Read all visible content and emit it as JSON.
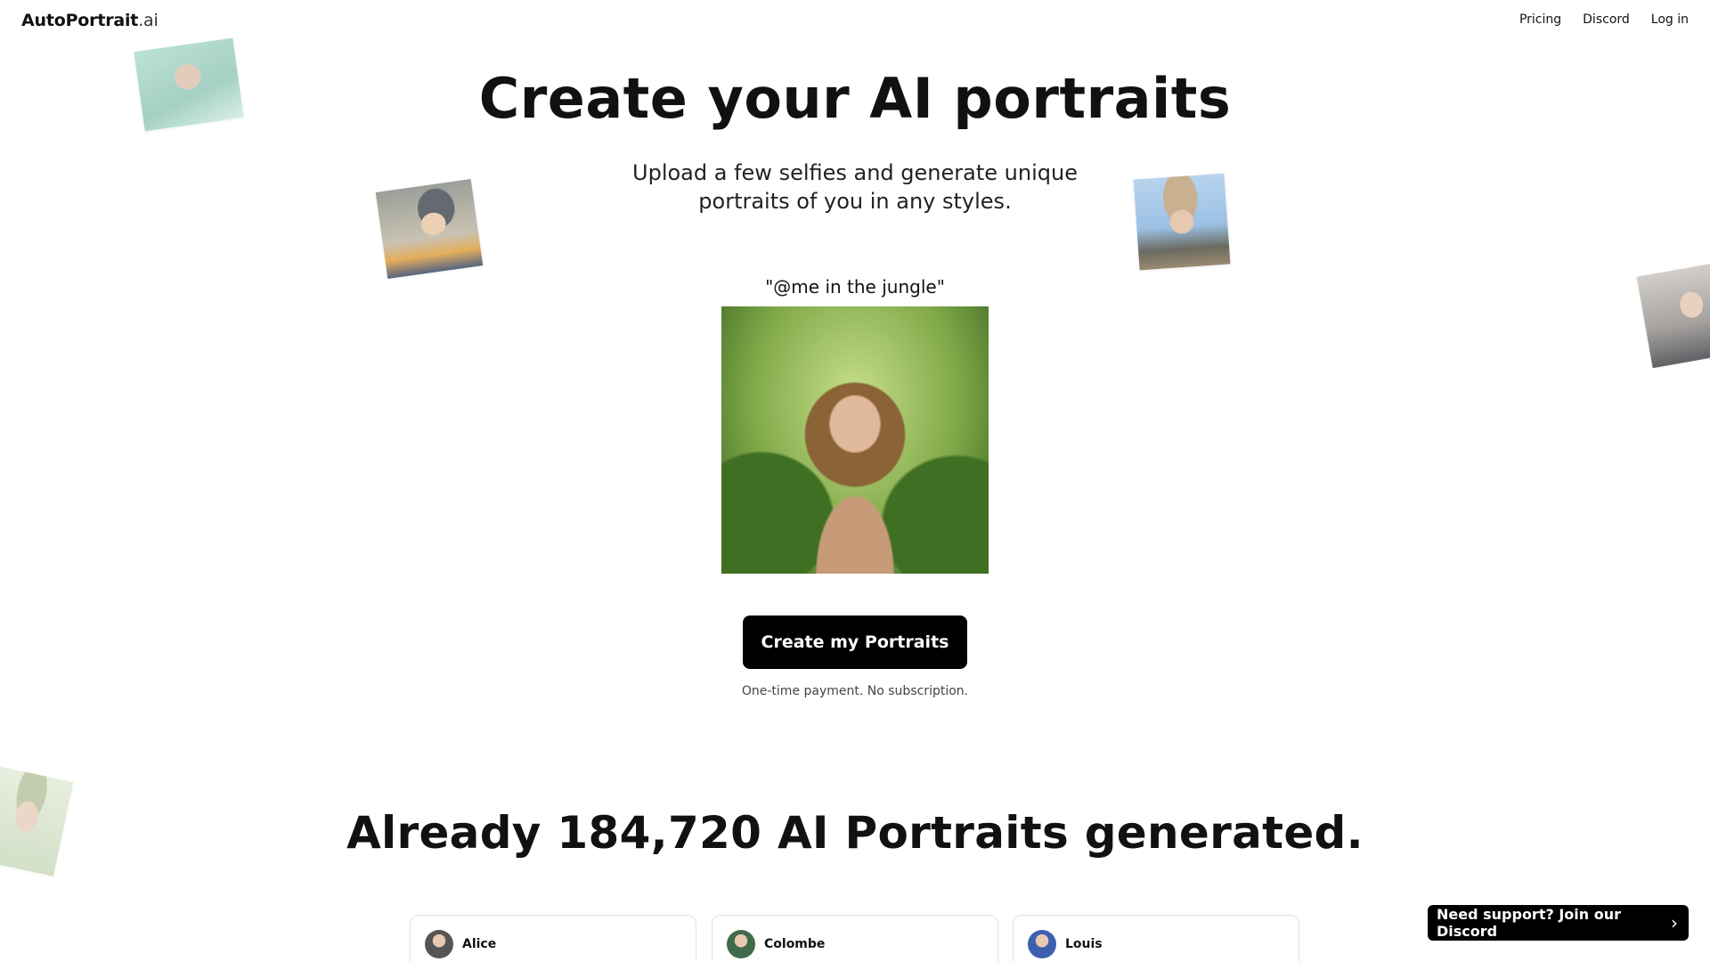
{
  "header": {
    "logo_main": "AutoPortrait",
    "logo_tld": ".ai",
    "nav": [
      "Pricing",
      "Discord",
      "Log in"
    ]
  },
  "hero": {
    "title": "Create your AI portraits",
    "subtitle": "Upload a few selfies and generate unique portraits of you in any styles.",
    "prompt_caption": "\"@me in the jungle\"",
    "cta_label": "Create my Portraits",
    "cta_note": "One-time payment. No subscription."
  },
  "stats": {
    "title": "Already 184,720 AI Portraits generated."
  },
  "testimonials": [
    {
      "name": "Alice",
      "avatar_color": "#555555"
    },
    {
      "name": "Colombe",
      "avatar_color": "#3f6b4a"
    },
    {
      "name": "Louis",
      "avatar_color": "#3d5fb0"
    }
  ],
  "support": {
    "label": "Need support? Join our Discord",
    "icon": "chevron-right-icon"
  }
}
